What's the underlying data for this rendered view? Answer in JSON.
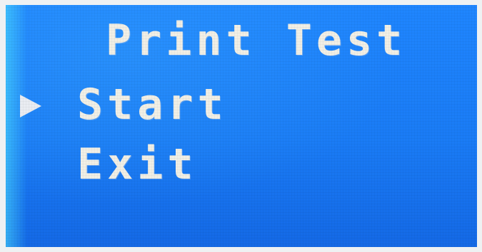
{
  "screen": {
    "title": "Print Test",
    "menu": {
      "items": [
        {
          "label": "Start",
          "selected": true
        },
        {
          "label": "Exit",
          "selected": false
        }
      ],
      "cursor_icon": "triangle-right-icon"
    },
    "colors": {
      "background": "#1a7cf6",
      "text": "#f1efe6"
    }
  }
}
